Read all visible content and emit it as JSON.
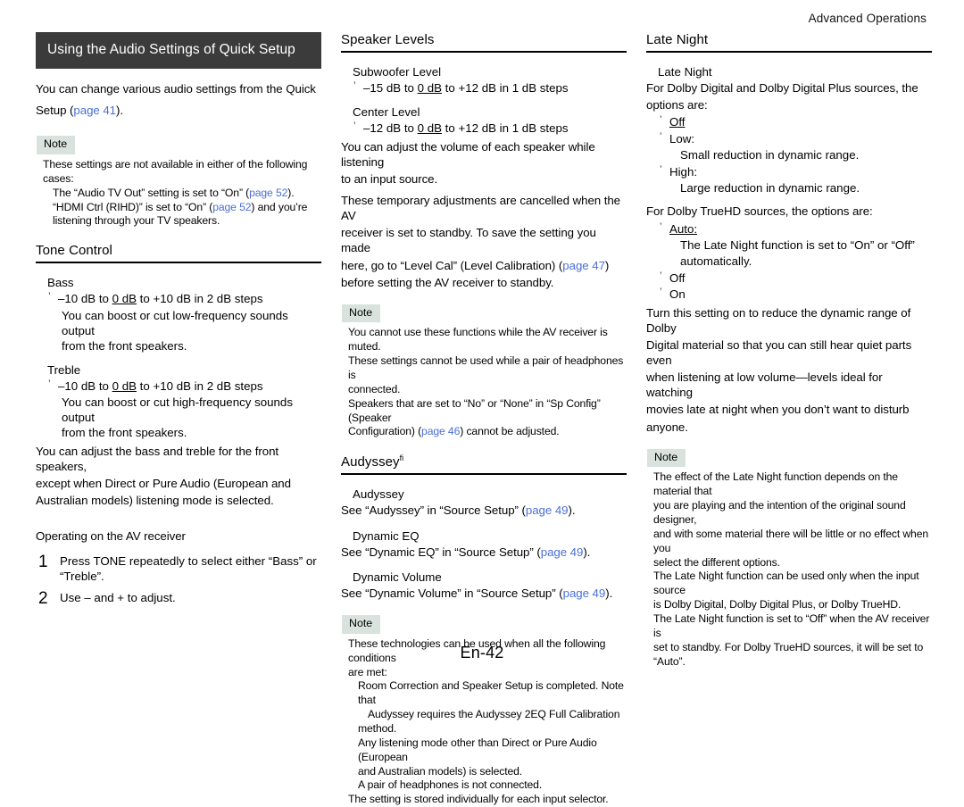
{
  "header": {
    "running_head": "Advanced Operations"
  },
  "footer": {
    "folio": "En-42"
  },
  "colors": {
    "title_bar_bg": "#3b3b3b",
    "note_badge_bg": "#d9e2dd",
    "link": "#4a6fd8",
    "rule": "#000000"
  },
  "labels": {
    "note": "Note"
  },
  "col1": {
    "title": "Using the Audio Settings of Quick Setup",
    "intro_a": "You can change various audio settings from the Quick",
    "intro_b_pre": "Setup (",
    "intro_b_link": "page 41",
    "intro_b_post": ").",
    "note1": [
      {
        "indent": 0,
        "text": "These settings are not available in either of the following cases:"
      },
      {
        "indent": 1,
        "text": "The “Audio TV Out” setting is set to “On” (",
        "link": "page 52",
        "after": ")."
      },
      {
        "indent": 1,
        "text": "“HDMI Ctrl (RIHD)” is set to “On” (",
        "link": "page 52",
        "after": ") and you’re"
      },
      {
        "indent": 1,
        "text": "listening through your TV speakers."
      }
    ],
    "tone_control": {
      "heading": "Tone Control",
      "bass_label": "Bass",
      "bass_value_pre": "–10 dB to ",
      "bass_value_mid": "0 dB",
      "bass_value_post": " to +10 dB in 2 dB steps",
      "bass_desc_1": "You can boost or cut low-frequency sounds output",
      "bass_desc_2": "from the front speakers.",
      "treble_label": "Treble",
      "treble_value_pre": "–10 dB to ",
      "treble_value_mid": "0 dB",
      "treble_value_post": " to +10 dB in 2 dB steps",
      "treble_desc_1": "You can boost or cut high-frequency sounds output",
      "treble_desc_2": "from the front speakers.",
      "para_1": "You can adjust the bass and treble for the front speakers,",
      "para_2": "except when Direct or Pure Audio (European and",
      "para_3": "Australian models) listening mode is selected."
    },
    "operating": {
      "heading": "Operating on the AV receiver",
      "steps": [
        {
          "num": "1",
          "line1": "Press TONE repeatedly to select either “Bass” or",
          "line2": "“Treble”."
        },
        {
          "num": "2",
          "line1": "Use – and + to adjust.",
          "line2": ""
        }
      ]
    }
  },
  "col2": {
    "speaker_levels": {
      "heading": "Speaker Levels",
      "sub_label": "Subwoofer Level",
      "sub_value_pre": "–15 dB to ",
      "sub_value_mid": "0 dB",
      "sub_value_post": " to +12 dB in 1 dB steps",
      "center_label": "Center Level",
      "center_value_pre": "–12 dB to ",
      "center_value_mid": "0 dB",
      "center_value_post": " to +12 dB in 1 dB steps",
      "para_1": "You can adjust the volume of each speaker while listening",
      "para_2": "to an input source.",
      "para_3": "These temporary adjustments are cancelled when the AV",
      "para_4": "receiver is set to standby. To save the setting you made",
      "para_5_pre": "here, go to “Level Cal” (Level Calibration) (",
      "para_5_link": "page 47",
      "para_5_post": ")",
      "para_6": "before setting the AV receiver to standby."
    },
    "note1": [
      {
        "indent": 0,
        "text": "You cannot use these functions while the AV receiver is muted."
      },
      {
        "indent": 0,
        "text": "These settings cannot be used while a pair of headphones is"
      },
      {
        "indent": 0,
        "text": "connected."
      },
      {
        "indent": 0,
        "text": "Speakers that are set to “No” or “None” in “Sp Config” (Speaker"
      },
      {
        "indent": 0,
        "text": "Configuration) (",
        "link": "page 46",
        "after": ") cannot be adjusted."
      }
    ],
    "audyssey": {
      "heading": "Audyssey",
      "heading_sup": "fi",
      "item1_label": "Audyssey",
      "item1_pre": "See “Audyssey” in “Source Setup” (",
      "item1_link": "page 49",
      "item1_post": ").",
      "item2_label": "Dynamic EQ",
      "item2_pre": "See “Dynamic EQ” in “Source Setup” (",
      "item2_link": "page 49",
      "item2_post": ").",
      "item3_label": "Dynamic Volume",
      "item3_pre": "See “Dynamic Volume” in “Source Setup” (",
      "item3_link": "page 49",
      "item3_post": ")."
    },
    "note2": [
      {
        "indent": 0,
        "text": "These technologies can be used when all the following conditions"
      },
      {
        "indent": 0,
        "text": "are met:"
      },
      {
        "indent": 1,
        "text": "Room Correction and Speaker Setup is completed. Note that"
      },
      {
        "indent": 2,
        "text": "Audyssey requires the Audyssey 2EQ Full Calibration"
      },
      {
        "indent": 1,
        "text": "method."
      },
      {
        "indent": 1,
        "text": "Any listening mode other than Direct or Pure Audio (European"
      },
      {
        "indent": 1,
        "text": "and Australian models) is selected."
      },
      {
        "indent": 1,
        "text": "A pair of headphones is not connected."
      },
      {
        "indent": 0,
        "text": "The setting is stored individually for each input selector."
      }
    ]
  },
  "col3": {
    "late_night": {
      "heading": "Late Night",
      "sub_label": "Late Night",
      "para_1": "For Dolby Digital and Dolby Digital Plus sources, the",
      "para_2": "options are:",
      "options_dd": [
        {
          "label": "Off",
          "underline": true,
          "desc": ""
        },
        {
          "label": "Low:",
          "underline": false,
          "desc": "Small reduction in dynamic range."
        },
        {
          "label": "High:",
          "underline": false,
          "desc": "Large reduction in dynamic range."
        }
      ],
      "para_3": "For Dolby TrueHD sources, the options are:",
      "options_thd": [
        {
          "label": "Auto:",
          "underline": true,
          "desc_1": "The Late Night function is set to “On” or “Off”",
          "desc_2": "automatically."
        },
        {
          "label": "Off",
          "underline": false,
          "desc_1": "",
          "desc_2": ""
        },
        {
          "label": "On",
          "underline": false,
          "desc_1": "",
          "desc_2": ""
        }
      ],
      "para_4": "Turn this setting on to reduce the dynamic range of Dolby",
      "para_5": "Digital material so that you can still hear quiet parts even",
      "para_6": "when listening at low volume—levels ideal for watching",
      "para_7": "movies late at night when you don’t want to disturb",
      "para_8": "anyone."
    },
    "note1": [
      {
        "indent": 0,
        "text": "The effect of the Late Night function depends on the material that"
      },
      {
        "indent": 0,
        "text": "you are playing and the intention of the original sound designer,"
      },
      {
        "indent": 0,
        "text": "and with some material there will be little or no effect when you"
      },
      {
        "indent": 0,
        "text": "select the different options."
      },
      {
        "indent": 0,
        "text": "The Late Night function can be used only when the input source"
      },
      {
        "indent": 0,
        "text": "is Dolby Digital, Dolby Digital Plus, or Dolby TrueHD."
      },
      {
        "indent": 0,
        "text": "The Late Night function is set to “Off” when the AV receiver is"
      },
      {
        "indent": 0,
        "text": "set to standby. For Dolby TrueHD sources, it will be set to"
      },
      {
        "indent": 0,
        "text": "“Auto”."
      }
    ]
  }
}
